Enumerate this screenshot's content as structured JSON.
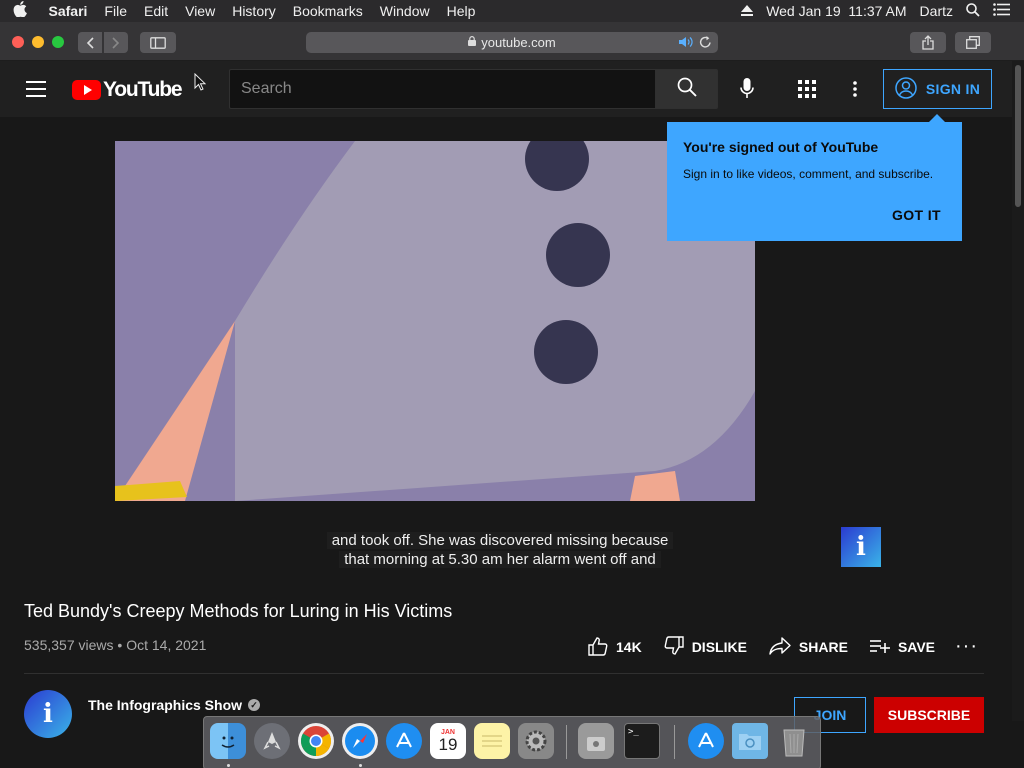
{
  "menubar": {
    "app_name": "Safari",
    "items": [
      "File",
      "Edit",
      "View",
      "History",
      "Bookmarks",
      "Window",
      "Help"
    ],
    "datetime": "Wed Jan 19  11:37 AM",
    "user": "Dartz"
  },
  "browser": {
    "url": "youtube.com"
  },
  "youtube": {
    "logo_text": "YouTube",
    "search_placeholder": "Search",
    "sign_in": "SIGN IN"
  },
  "popup": {
    "title": "You're signed out of YouTube",
    "text": "Sign in to like videos, comment, and subscribe.",
    "button": "GOT IT"
  },
  "video": {
    "caption_line1": "and took off. She was discovered missing because",
    "caption_line2": "that morning at 5.30 am her alarm went off and",
    "title": "Ted Bundy's Creepy Methods for Luring in His Victims",
    "views": "535,357 views",
    "date": "Oct 14, 2021",
    "likes": "14K",
    "dislike": "DISLIKE",
    "share": "SHARE",
    "save": "SAVE"
  },
  "channel": {
    "name": "The Infographics Show",
    "logo_letter": "i",
    "join": "JOIN",
    "subscribe": "SUBSCRIBE"
  },
  "dock": {
    "calendar_month": "JAN",
    "calendar_day": "19"
  },
  "colors": {
    "accent_blue": "#3ea6ff",
    "youtube_red": "#ff0000",
    "subscribe_red": "#cc0000",
    "background": "#181818"
  },
  "icons": [
    "apple-icon",
    "search-icon",
    "microphone-icon",
    "apps-grid-icon",
    "more-vertical-icon",
    "account-icon",
    "like-icon",
    "dislike-icon",
    "share-icon",
    "save-playlist-icon"
  ]
}
